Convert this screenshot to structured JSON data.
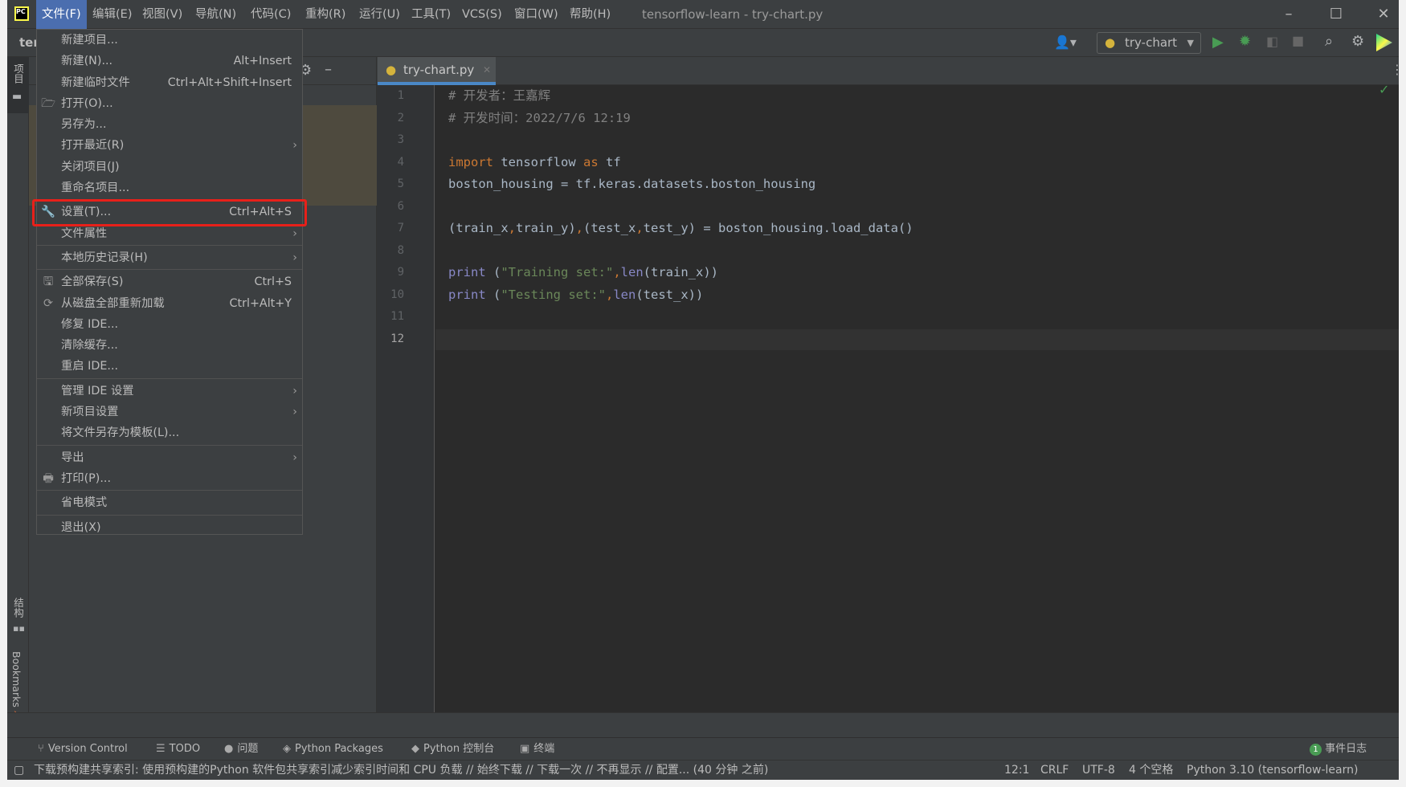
{
  "titlebar": {
    "logo": "PC",
    "menus": [
      "文件(F)",
      "编辑(E)",
      "视图(V)",
      "导航(N)",
      "代码(C)",
      "重构(R)",
      "运行(U)",
      "工具(T)",
      "VCS(S)",
      "窗口(W)",
      "帮助(H)"
    ],
    "title": "tensorflow-learn - try-chart.py"
  },
  "toolbar": {
    "project_name": "ter",
    "run_config": "try-chart"
  },
  "stripe": {
    "project": "项目",
    "structure": "结构",
    "bookmarks": "Bookmarks"
  },
  "tab": {
    "label": "try-chart.py"
  },
  "editor": {
    "line_numbers": [
      "1",
      "2",
      "3",
      "4",
      "5",
      "6",
      "7",
      "8",
      "9",
      "10",
      "11",
      "12"
    ],
    "current_line": "12",
    "lines": [
      [
        {
          "t": "# 开发者：王嘉辉",
          "c": "cm"
        }
      ],
      [
        {
          "t": "# 开发时间：2022/7/6 12:19",
          "c": "cm"
        }
      ],
      [],
      [
        {
          "t": "import",
          "c": "kw"
        },
        {
          "t": " tensorflow ",
          "c": "tx"
        },
        {
          "t": "as",
          "c": "kw"
        },
        {
          "t": " tf",
          "c": "tx"
        }
      ],
      [
        {
          "t": "boston_housing = tf.keras.datasets.boston_housing",
          "c": "tx"
        }
      ],
      [],
      [
        {
          "t": "(train_x",
          "c": "tx"
        },
        {
          "t": ",",
          "c": "kw"
        },
        {
          "t": "train_y)",
          "c": "tx"
        },
        {
          "t": ",",
          "c": "kw"
        },
        {
          "t": "(test_x",
          "c": "tx"
        },
        {
          "t": ",",
          "c": "kw"
        },
        {
          "t": "test_y) = boston_housing.load_data()",
          "c": "tx"
        }
      ],
      [],
      [
        {
          "t": "print",
          "c": "bi"
        },
        {
          "t": " (",
          "c": "tx"
        },
        {
          "t": "\"Training set:\"",
          "c": "st"
        },
        {
          "t": ",",
          "c": "kw"
        },
        {
          "t": "len",
          "c": "bi"
        },
        {
          "t": "(train_x))",
          "c": "tx"
        }
      ],
      [
        {
          "t": "print",
          "c": "bi"
        },
        {
          "t": " (",
          "c": "tx"
        },
        {
          "t": "\"Testing set:\"",
          "c": "st"
        },
        {
          "t": ",",
          "c": "kw"
        },
        {
          "t": "len",
          "c": "bi"
        },
        {
          "t": "(test_x))",
          "c": "tx"
        }
      ],
      [],
      []
    ]
  },
  "file_menu": {
    "items": [
      {
        "label": "新建项目..."
      },
      {
        "label": "新建(N)...",
        "shortcut": "Alt+Insert"
      },
      {
        "label": "新建临时文件",
        "shortcut": "Ctrl+Alt+Shift+Insert"
      },
      {
        "label": "打开(O)...",
        "icon": "folder-open-icon"
      },
      {
        "label": "另存为..."
      },
      {
        "label": "打开最近(R)",
        "submenu": true
      },
      {
        "label": "关闭项目(J)"
      },
      {
        "label": "重命名项目..."
      },
      {
        "sep": true
      },
      {
        "label": "设置(T)...",
        "shortcut": "Ctrl+Alt+S",
        "icon": "wrench-icon",
        "highlighted": true
      },
      {
        "label": "文件属性",
        "submenu": true
      },
      {
        "sep": true
      },
      {
        "label": "本地历史记录(H)",
        "submenu": true
      },
      {
        "sep": true
      },
      {
        "label": "全部保存(S)",
        "shortcut": "Ctrl+S",
        "icon": "save-icon"
      },
      {
        "label": "从磁盘全部重新加载",
        "shortcut": "Ctrl+Alt+Y",
        "icon": "reload-icon"
      },
      {
        "label": "修复 IDE..."
      },
      {
        "label": "清除缓存..."
      },
      {
        "label": "重启 IDE..."
      },
      {
        "sep": true
      },
      {
        "label": "管理 IDE 设置",
        "submenu": true
      },
      {
        "label": "新项目设置",
        "submenu": true
      },
      {
        "label": "将文件另存为模板(L)..."
      },
      {
        "sep": true
      },
      {
        "label": "导出",
        "submenu": true
      },
      {
        "label": "打印(P)...",
        "icon": "printer-icon"
      },
      {
        "sep": true
      },
      {
        "label": "省电模式"
      },
      {
        "sep": true
      },
      {
        "label": "退出(X)"
      }
    ]
  },
  "tool_windows": [
    "Version Control",
    "TODO",
    "问题",
    "Python Packages",
    "Python 控制台",
    "终端"
  ],
  "event_log": {
    "count": "1",
    "label": "事件日志"
  },
  "status": {
    "message": "下载预构建共享索引: 使用预构建的Python 软件包共享索引减少索引时间和 CPU 负载 // 始终下载 // 下载一次 // 不再显示 // 配置... (40 分钟 之前)",
    "position": "12:1",
    "line_sep": "CRLF",
    "encoding": "UTF-8",
    "indent": "4 个空格",
    "interpreter": "Python 3.10 (tensorflow-learn)"
  },
  "colors": {
    "accent": "#4b6eaf",
    "highlight_box": "#e8201a",
    "run": "#499c54"
  }
}
